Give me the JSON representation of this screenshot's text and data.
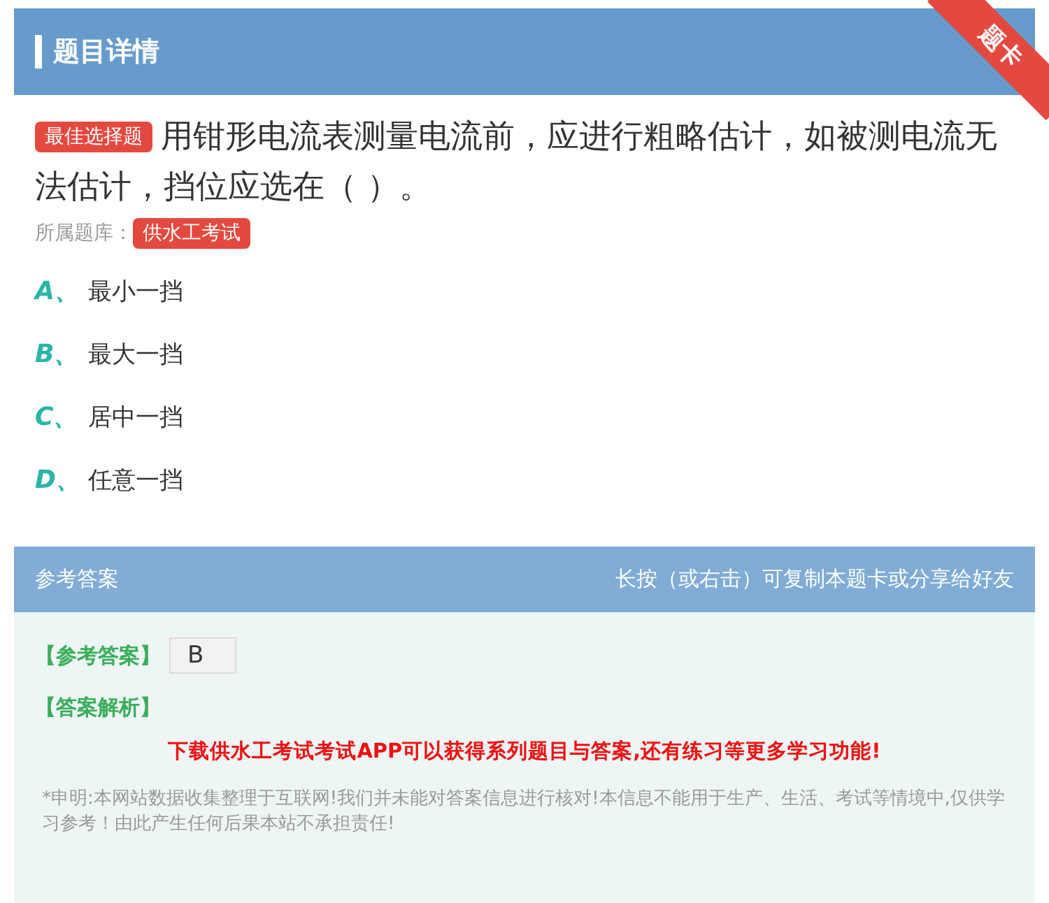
{
  "header": {
    "title": "题目详情",
    "ribbon": "题卡"
  },
  "question": {
    "type_badge": "最佳选择题",
    "text": "用钳形电流表测量电流前，应进行粗略估计，如被测电流无法估计，挡位应选在（ ）。",
    "bank_label": "所属题库：",
    "bank": "供水工考试"
  },
  "options": [
    {
      "letter": "A、",
      "text": "最小一挡"
    },
    {
      "letter": "B、",
      "text": "最大一挡"
    },
    {
      "letter": "C、",
      "text": "居中一挡"
    },
    {
      "letter": "D、",
      "text": "任意一挡"
    }
  ],
  "answer": {
    "title": "参考答案",
    "hint": "长按（或右击）可复制本题卡或分享给好友",
    "answer_label": "【参考答案】",
    "answer_value": "B",
    "analysis_label": "【答案解析】",
    "promo": "下载供水工考试考试APP可以获得系列题目与答案,还有练习等更多学习功能!",
    "disclaimer": "*申明:本网站数据收集整理于互联网!我们并未能对答案信息进行核对!本信息不能用于生产、生活、考试等情境中,仅供学习参考！由此产生任何后果本站不承担责任!"
  }
}
